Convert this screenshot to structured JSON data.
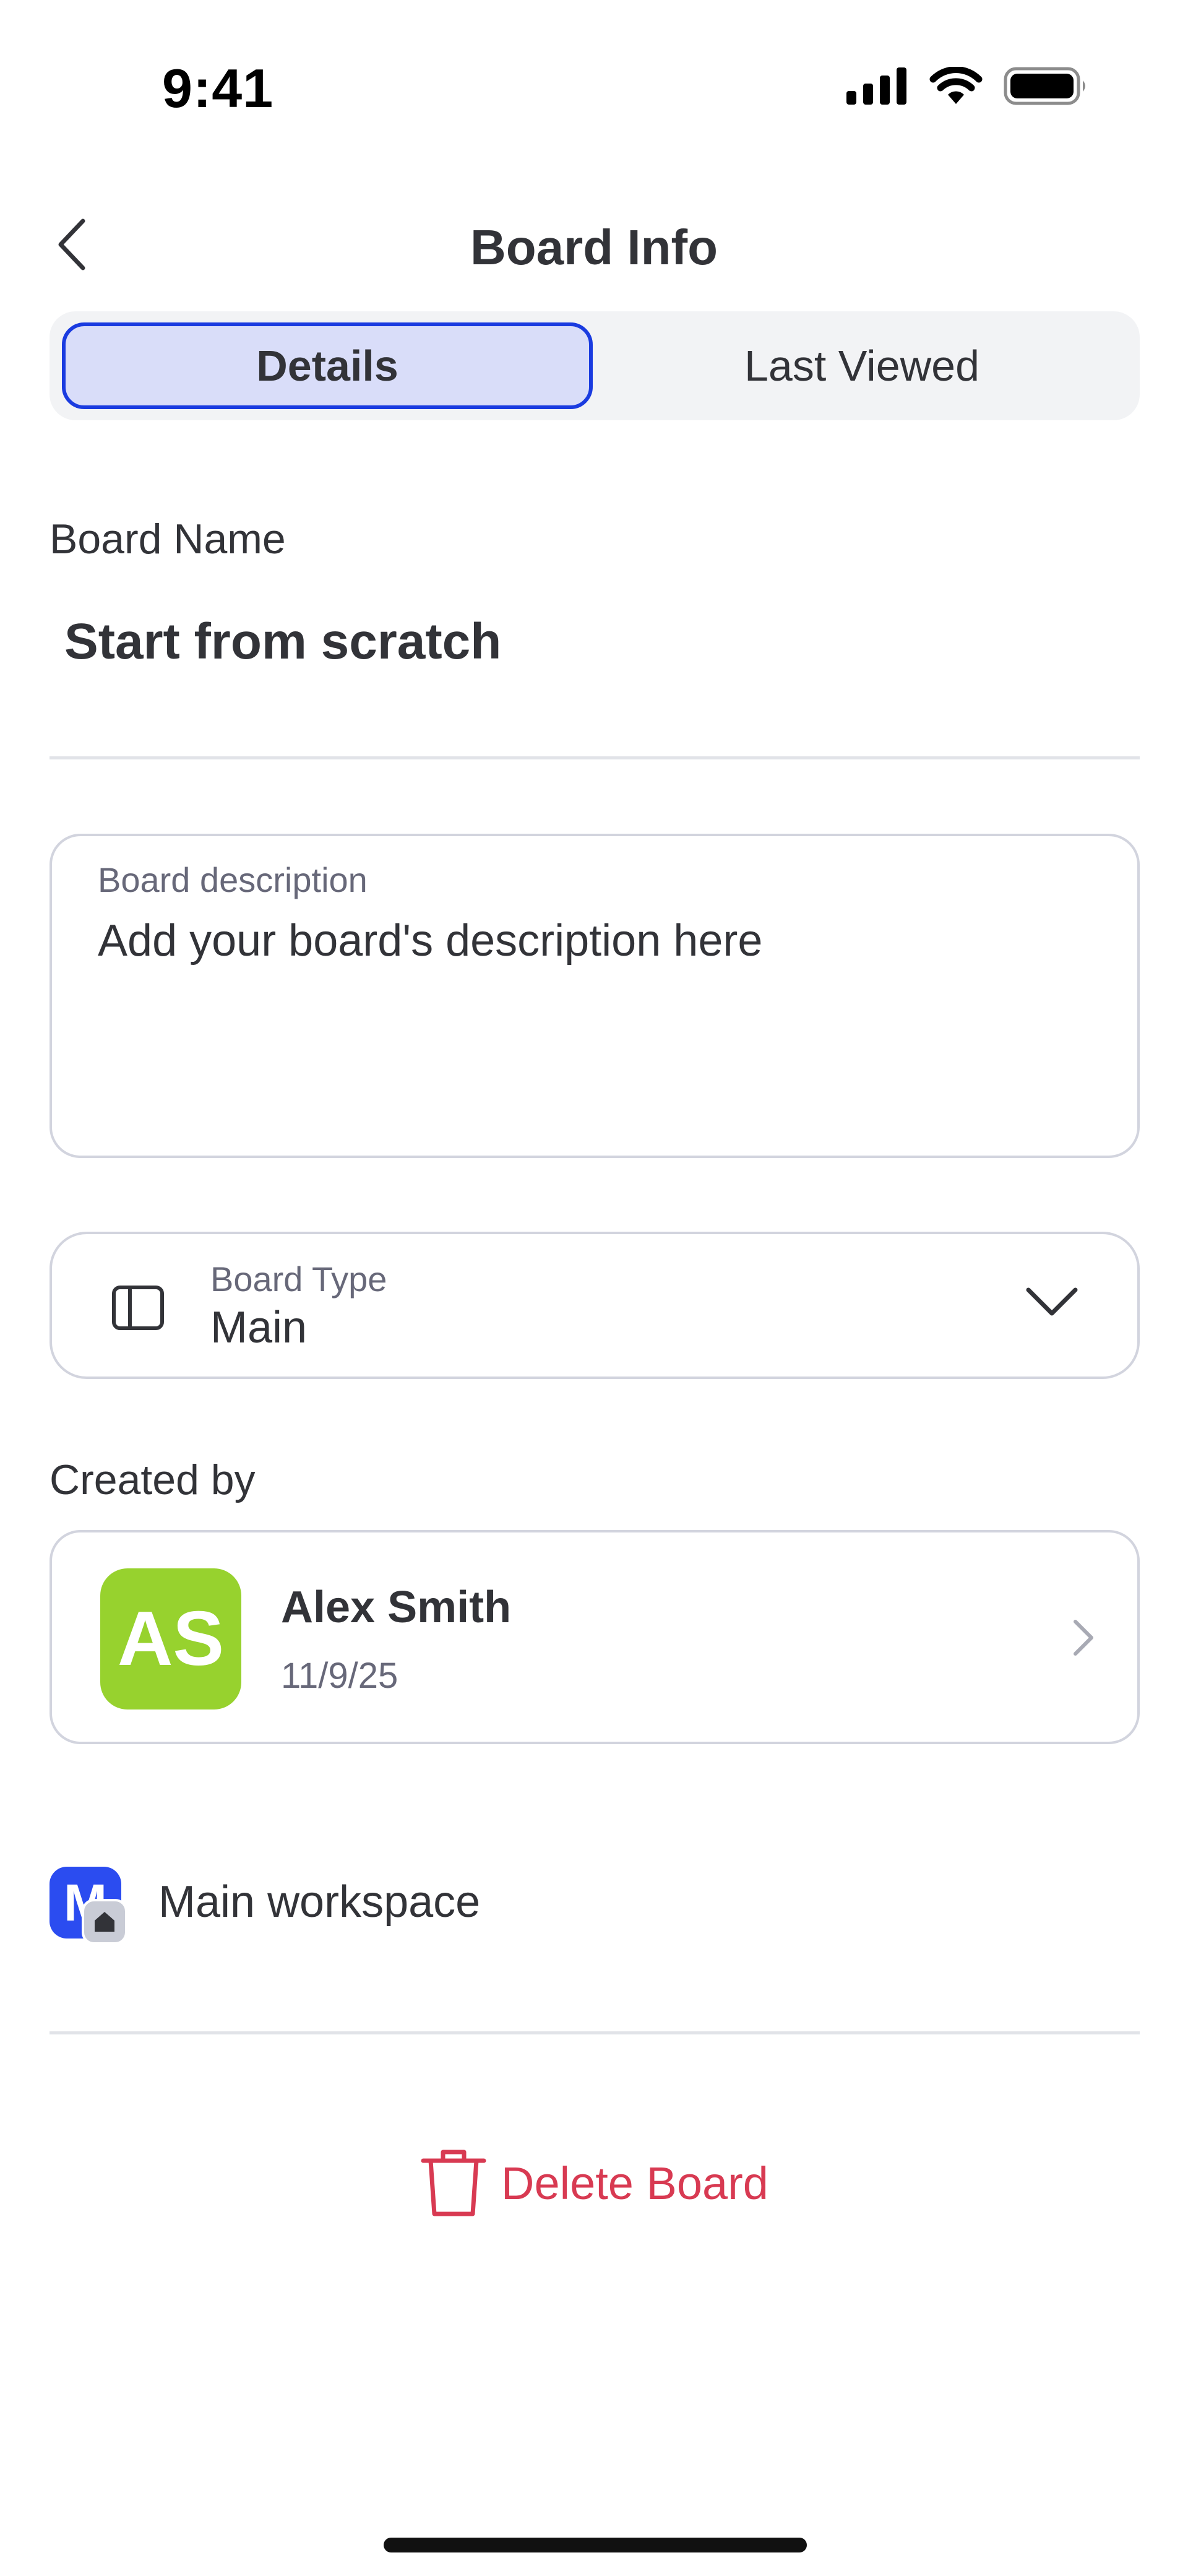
{
  "status_bar": {
    "time": "9:41",
    "icons": [
      "cellular-signal-icon",
      "wifi-icon",
      "battery-icon"
    ]
  },
  "nav": {
    "title": "Board Info",
    "back_icon": "chevron-left-icon"
  },
  "tabs": [
    {
      "label": "Details",
      "active": true
    },
    {
      "label": "Last Viewed",
      "active": false
    }
  ],
  "board_name": {
    "label": "Board Name",
    "value": "Start from scratch"
  },
  "description": {
    "label": "Board description",
    "placeholder": "Add your board's description here"
  },
  "board_type": {
    "label": "Board Type",
    "value": "Main",
    "icon": "board-layout-icon"
  },
  "created_by": {
    "label": "Created by",
    "avatar_initials": "AS",
    "name": "Alex Smith",
    "date": "11/9/25"
  },
  "workspace": {
    "icon_letter": "M",
    "name": "Main workspace"
  },
  "delete": {
    "label": "Delete Board",
    "icon": "trash-icon"
  },
  "colors": {
    "accent": "#1a3be0",
    "active_tab_bg": "#d9ddf9",
    "avatar_bg": "#97d22e",
    "workspace_bg": "#2b4cf0",
    "danger": "#d83a52",
    "border": "#d2d4de"
  }
}
